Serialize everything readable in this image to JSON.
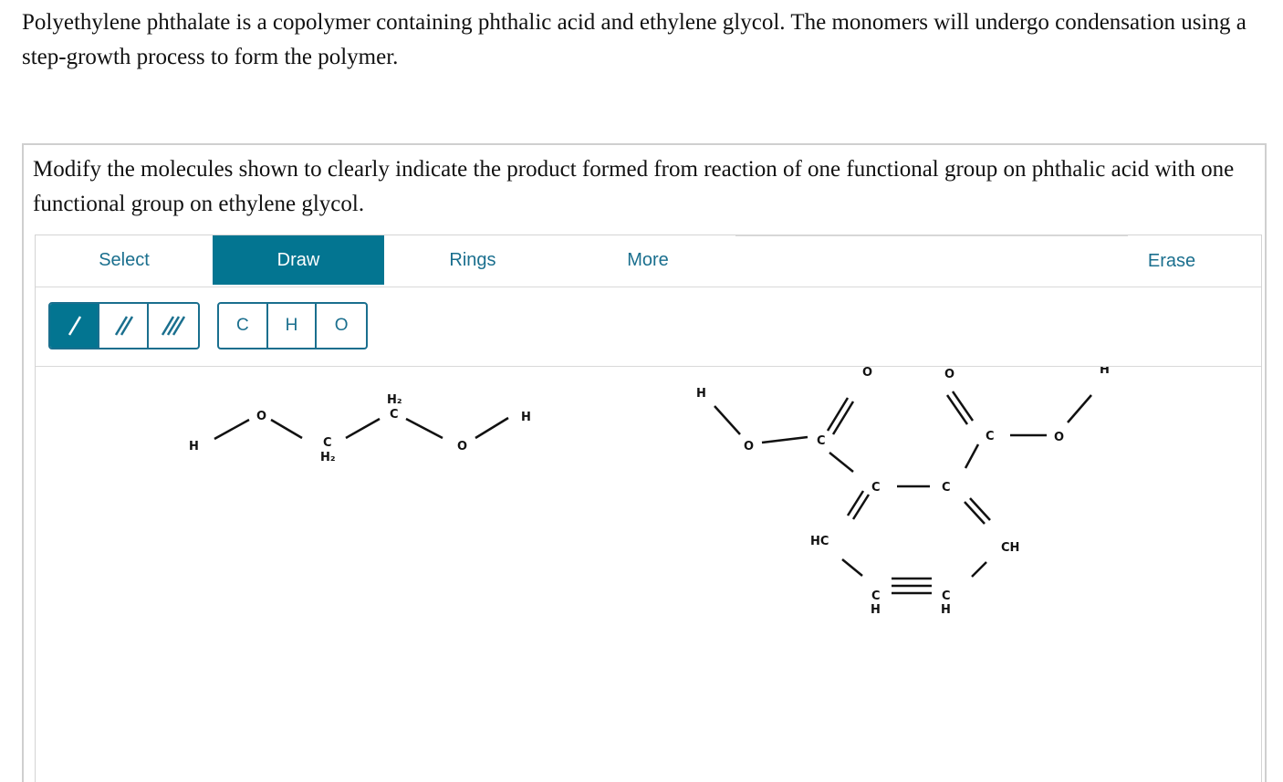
{
  "intro_text": "Polyethylene phthalate is a copolymer containing phthalic acid and ethylene glycol. The monomers will undergo condensation using a step-growth process to form the polymer.",
  "question_prompt": "Modify the molecules shown to clearly indicate the product formed from reaction of one functional group on phthalic acid with one functional group on ethylene glycol.",
  "editor": {
    "tabs": [
      {
        "label": "Select",
        "active": false
      },
      {
        "label": "Draw",
        "active": true
      },
      {
        "label": "Rings",
        "active": false
      },
      {
        "label": "More",
        "active": false
      }
    ],
    "erase_label": "Erase",
    "bond_tools": [
      "single-bond",
      "double-bond",
      "triple-bond"
    ],
    "active_bond_tool": "single-bond",
    "atom_tools": [
      "C",
      "H",
      "O"
    ],
    "accent_color": "#037591"
  },
  "molecules": {
    "ethylene_glycol": {
      "atoms": [
        {
          "id": "h1",
          "text": "H"
        },
        {
          "id": "o1",
          "text": "O"
        },
        {
          "id": "c1",
          "text": "C",
          "h2": "H₂"
        },
        {
          "id": "c2",
          "text": "C",
          "h2": "H₂"
        },
        {
          "id": "o2",
          "text": "O"
        },
        {
          "id": "h2",
          "text": "H"
        }
      ]
    },
    "phthalic_acid": {
      "atoms": [
        {
          "id": "ha",
          "text": "H"
        },
        {
          "id": "oa",
          "text": "O"
        },
        {
          "id": "ca",
          "text": "C"
        },
        {
          "id": "oca",
          "text": "O"
        },
        {
          "id": "r1",
          "text": "C"
        },
        {
          "id": "r2",
          "text": "C"
        },
        {
          "id": "r3",
          "text": "CH"
        },
        {
          "id": "r4",
          "text": "C",
          "h": "H"
        },
        {
          "id": "r5",
          "text": "C",
          "h": "H"
        },
        {
          "id": "r6",
          "text": "HC"
        },
        {
          "id": "cb",
          "text": "C"
        },
        {
          "id": "ocb",
          "text": "O"
        },
        {
          "id": "ob",
          "text": "O"
        },
        {
          "id": "hb",
          "text": "H"
        }
      ]
    }
  }
}
